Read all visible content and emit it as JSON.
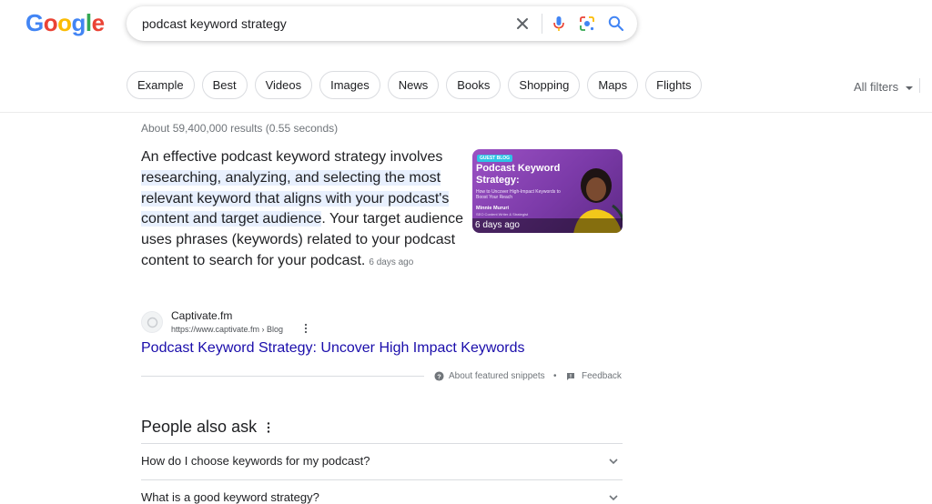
{
  "logo": {
    "text": "Google",
    "letters": [
      {
        "ch": "G",
        "color": "#4285F4"
      },
      {
        "ch": "o",
        "color": "#EA4335"
      },
      {
        "ch": "o",
        "color": "#FBBC05"
      },
      {
        "ch": "g",
        "color": "#4285F4"
      },
      {
        "ch": "l",
        "color": "#34A853"
      },
      {
        "ch": "e",
        "color": "#EA4335"
      }
    ]
  },
  "search": {
    "query": "podcast keyword strategy"
  },
  "chips": [
    "Example",
    "Best",
    "Videos",
    "Images",
    "News",
    "Books",
    "Shopping",
    "Maps",
    "Flights"
  ],
  "filters": {
    "all_filters": "All filters"
  },
  "results": {
    "stats": "About 59,400,000 results (0.55 seconds)",
    "featured": {
      "text_before": "An effective podcast keyword strategy involves ",
      "text_highlight": "researching, analyzing, and selecting the most relevant keyword that aligns with your podcast's content and target audience",
      "text_after": ". Your target audience uses phrases (keywords) related to your podcast content to search for your podcast.",
      "date": "6 days ago",
      "thumbnail": {
        "tag": "GUEST BLOG",
        "title": "Podcast Keyword Strategy:",
        "subtitle": "How to Uncover High-Impact Keywords to Boost Your Reach",
        "author": "Minnie Mururi",
        "role": "SEO Content Writer & Strategist",
        "date": "6 days ago"
      },
      "source": {
        "site_name": "Captivate.fm",
        "url": "https://www.captivate.fm › Blog"
      },
      "link_title": "Podcast Keyword Strategy: Uncover High Impact Keywords",
      "about_label": "About featured snippets",
      "separator": "•",
      "feedback_label": "Feedback"
    }
  },
  "people_also_ask": {
    "title": "People also ask",
    "questions": [
      "How do I choose keywords for my podcast?",
      "What is a good keyword strategy?"
    ]
  },
  "colors": {
    "link": "#1a0dab",
    "highlight": "#e8f0fe",
    "mic_blue": "#4285F4",
    "mic_red": "#EA4335"
  },
  "icons": [
    "clear-icon",
    "mic-icon",
    "lens-icon",
    "search-icon",
    "kebab-icon",
    "help-icon",
    "feedback-icon",
    "chevron-down-icon"
  ]
}
